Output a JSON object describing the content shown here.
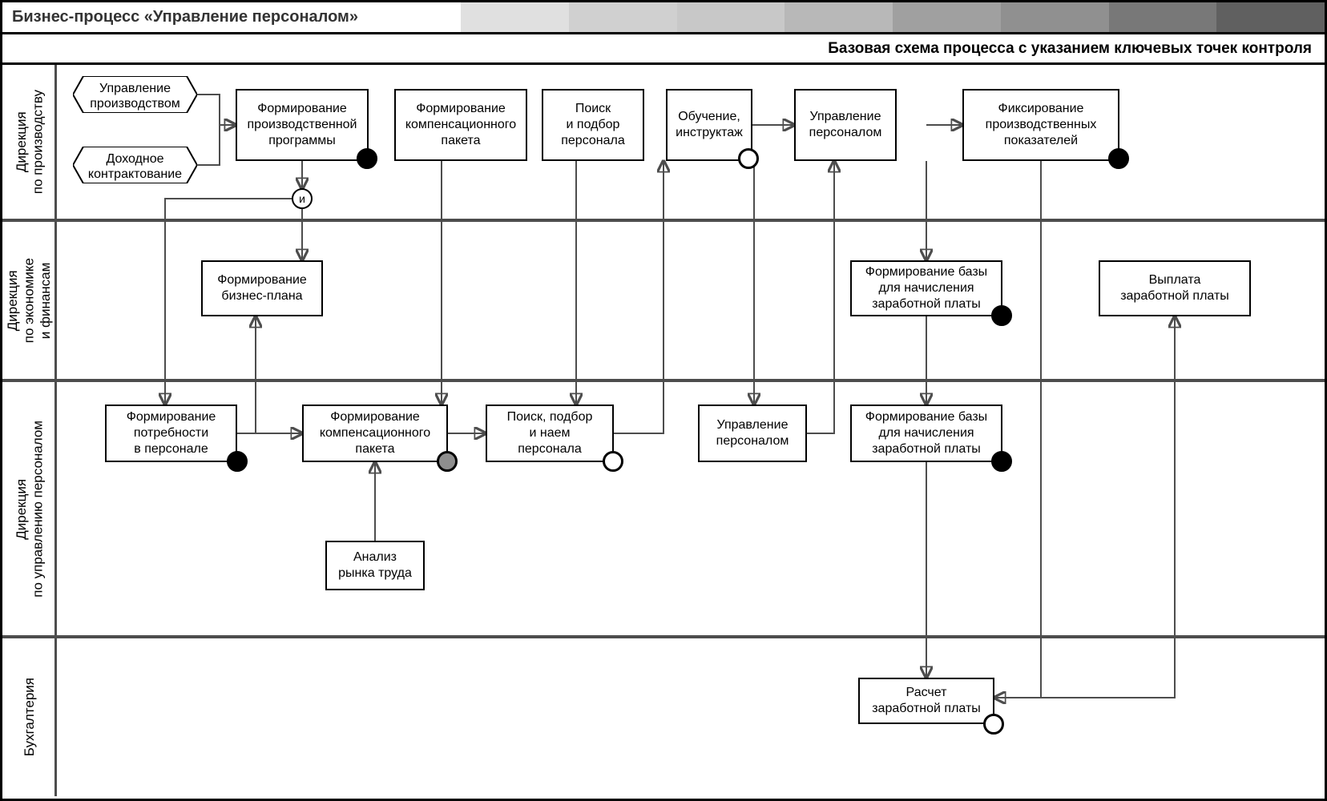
{
  "title": "Бизнес-процесс «Управление персоналом»",
  "subtitle": "Базовая схема процесса с указанием ключевых точек контроля",
  "lanes": {
    "l1": "Дирекция\nпо производству",
    "l2": "Дирекция\nпо экономике\nи финансам",
    "l3": "Дирекция\nпо управлению персоналом",
    "l4": "Бухгалтерия"
  },
  "inputs": {
    "in1": "Управление\nпроизводством",
    "in2": "Доходное\nконтрактование"
  },
  "p": {
    "a1": "Формирование\nпроизводственной\nпрограммы",
    "a2": "Формирование\nкомпенсационного\nпакета",
    "a3": "Поиск\nи подбор\nперсонала",
    "a4": "Обучение,\nинструктаж",
    "a5": "Управление\nперсоналом",
    "a6": "Фиксирование\nпроизводственных\nпоказателей",
    "b1": "Формирование\nбизнес-плана",
    "b2": "Формирование базы\nдля начисления\nзаработной платы",
    "b3": "Выплата\nзаработной платы",
    "c1": "Формирование\nпотребности\nв персонале",
    "c2": "Формирование\nкомпенсационного\nпакета",
    "c3": "Поиск, подбор\nи наем\nперсонала",
    "c4": "Управление\nперсоналом",
    "c5": "Формирование базы\nдля начисления\nзаработной платы",
    "c6": "Анализ\nрынка труда",
    "d1": "Расчет\nзаработной платы"
  },
  "gate": "и"
}
